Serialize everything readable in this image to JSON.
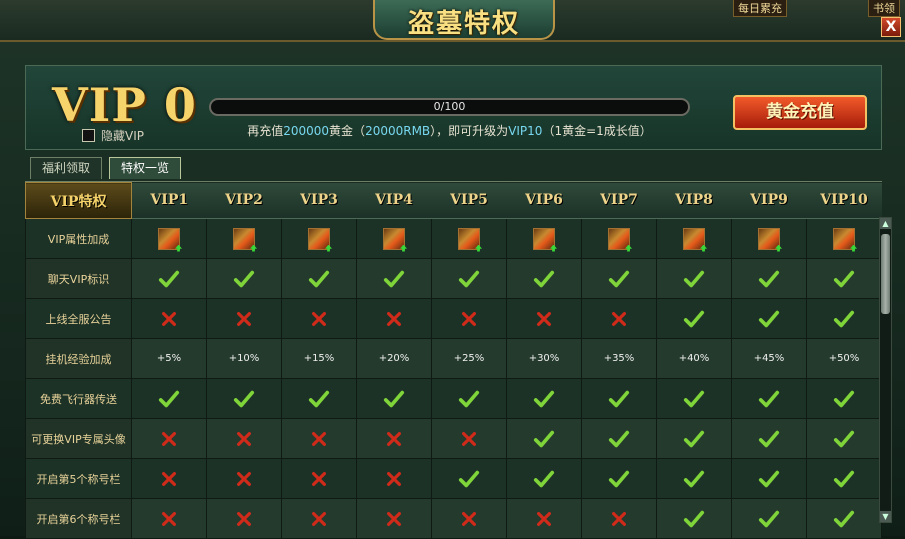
{
  "window": {
    "title": "盗墓特权",
    "close_label": "X",
    "corner_left": "每日累充",
    "corner_right": "书领"
  },
  "vip": {
    "level_text": "VIP 0",
    "hide_label": "隐藏VIP",
    "hide_checked": false
  },
  "progress": {
    "text": "0/100",
    "fraction": 0.0
  },
  "upgrade": {
    "prefix": "再充值",
    "gold_amount": "200000",
    "gold_word": "黄金（",
    "rmb": "20000RMB",
    "mid": "），即可升级为",
    "target": "VIP10",
    "suffix": "（1黄金=1成长值）"
  },
  "recharge_button": "黄金充值",
  "tabs": [
    {
      "label": "福利领取",
      "active": false
    },
    {
      "label": "特权一览",
      "active": true
    }
  ],
  "table": {
    "corner_header": "VIP特权",
    "columns": [
      "VIP1",
      "VIP2",
      "VIP3",
      "VIP4",
      "VIP5",
      "VIP6",
      "VIP7",
      "VIP8",
      "VIP9",
      "VIP10"
    ],
    "rows": [
      {
        "label": "VIP属性加成",
        "cells": [
          "sword",
          "sword",
          "sword",
          "sword",
          "sword",
          "sword",
          "sword",
          "sword",
          "sword",
          "sword"
        ]
      },
      {
        "label": "聊天VIP标识",
        "cells": [
          "check",
          "check",
          "check",
          "check",
          "check",
          "check",
          "check",
          "check",
          "check",
          "check"
        ]
      },
      {
        "label": "上线全服公告",
        "cells": [
          "cross",
          "cross",
          "cross",
          "cross",
          "cross",
          "cross",
          "cross",
          "check",
          "check",
          "check"
        ]
      },
      {
        "label": "挂机经验加成",
        "cells": [
          "+5%",
          "+10%",
          "+15%",
          "+20%",
          "+25%",
          "+30%",
          "+35%",
          "+40%",
          "+45%",
          "+50%"
        ]
      },
      {
        "label": "免费飞行器传送",
        "cells": [
          "check",
          "check",
          "check",
          "check",
          "check",
          "check",
          "check",
          "check",
          "check",
          "check"
        ]
      },
      {
        "label": "可更换VIP专属头像",
        "cells": [
          "cross",
          "cross",
          "cross",
          "cross",
          "cross",
          "check",
          "check",
          "check",
          "check",
          "check"
        ]
      },
      {
        "label": "开启第5个称号栏",
        "cells": [
          "cross",
          "cross",
          "cross",
          "cross",
          "check",
          "check",
          "check",
          "check",
          "check",
          "check"
        ]
      },
      {
        "label": "开启第6个称号栏",
        "cells": [
          "cross",
          "cross",
          "cross",
          "cross",
          "cross",
          "cross",
          "cross",
          "check",
          "check",
          "check"
        ]
      }
    ]
  },
  "colors": {
    "gold": "#f6d36b",
    "check": "#7fd43a",
    "cross": "#d02a1a",
    "highlight": "#78d8f0"
  }
}
